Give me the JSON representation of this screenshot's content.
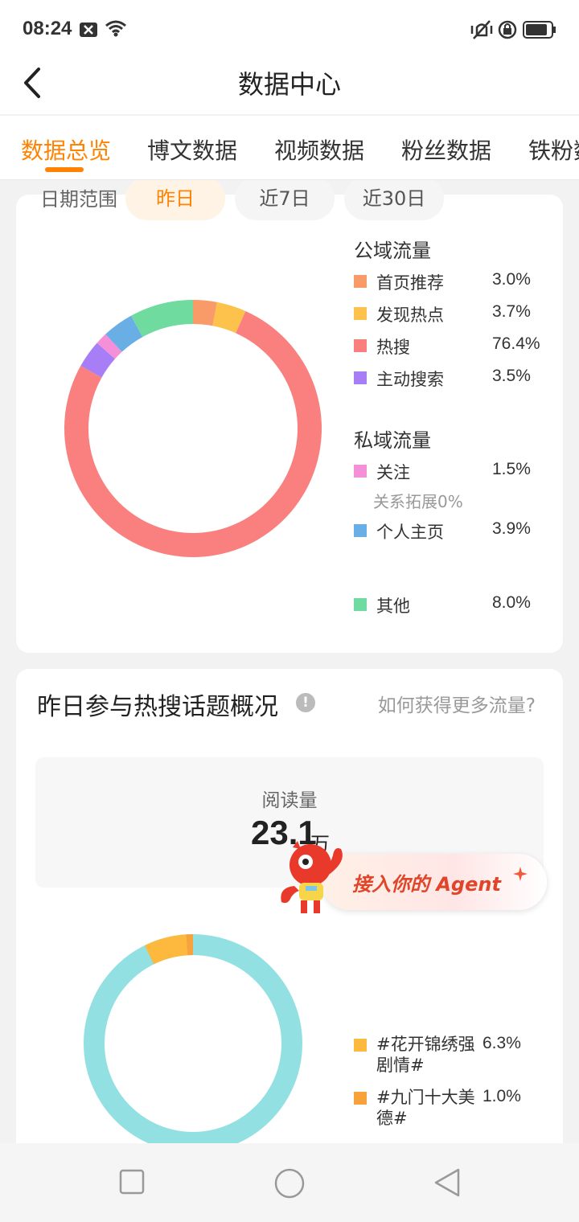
{
  "status_bar": {
    "time": "08:24"
  },
  "header": {
    "title": "数据中心"
  },
  "tabs": [
    {
      "label": "数据总览",
      "active": true
    },
    {
      "label": "博文数据",
      "active": false
    },
    {
      "label": "视频数据",
      "active": false
    },
    {
      "label": "粉丝数据",
      "active": false
    },
    {
      "label": "铁粉数",
      "active": false
    }
  ],
  "date_range": {
    "label": "日期范围",
    "options": [
      "昨日",
      "近7日",
      "近30日"
    ],
    "selected": "昨日"
  },
  "traffic": {
    "public_title": "公域流量",
    "private_title": "私域流量",
    "public_items": [
      {
        "name": "首页推荐",
        "value": "3.0%",
        "color": "#f99b69"
      },
      {
        "name": "发现热点",
        "value": "3.7%",
        "color": "#fcc24b"
      },
      {
        "name": "热搜",
        "value": "76.4%",
        "color": "#fa8080"
      },
      {
        "name": "主动搜索",
        "value": "3.5%",
        "color": "#a87ef7"
      }
    ],
    "private_items": [
      {
        "name": "关注",
        "value": "1.5%",
        "color": "#f48fd8"
      },
      {
        "name": "个人主页",
        "value": "3.9%",
        "color": "#6aaee6"
      }
    ],
    "relation_note": "关系拓展0%",
    "other": {
      "name": "其他",
      "value": "8.0%",
      "color": "#6fdb9e"
    }
  },
  "hot_topics": {
    "title": "昨日参与热搜话题概况",
    "help_link": "如何获得更多流量?",
    "read_label": "阅读量",
    "read_value": "23.1",
    "read_unit": "万",
    "items": [
      {
        "name": "#花开锦绣强剧情#",
        "value": "6.3%",
        "color": "#fcb93e"
      },
      {
        "name": "#九门十大美德#",
        "value": "1.0%",
        "color": "#f7a23a"
      }
    ],
    "main_color": "#93e0e3"
  },
  "agent_banner": {
    "text": "接入你的 Agent"
  },
  "chart_data": [
    {
      "type": "pie",
      "categories": [
        "首页推荐",
        "发现热点",
        "热搜",
        "主动搜索",
        "关注",
        "个人主页",
        "其他"
      ],
      "values": [
        3.0,
        3.7,
        76.4,
        3.5,
        1.5,
        3.9,
        8.0
      ],
      "colors": [
        "#f99b69",
        "#fcc24b",
        "#fa8080",
        "#a87ef7",
        "#f48fd8",
        "#6aaee6",
        "#6fdb9e"
      ]
    },
    {
      "type": "pie",
      "categories": [
        "#花开锦绣强剧情#",
        "#九门十大美德#"
      ],
      "values": [
        6.3,
        1.0
      ],
      "colors": [
        "#fcb93e",
        "#f7a23a"
      ]
    }
  ]
}
